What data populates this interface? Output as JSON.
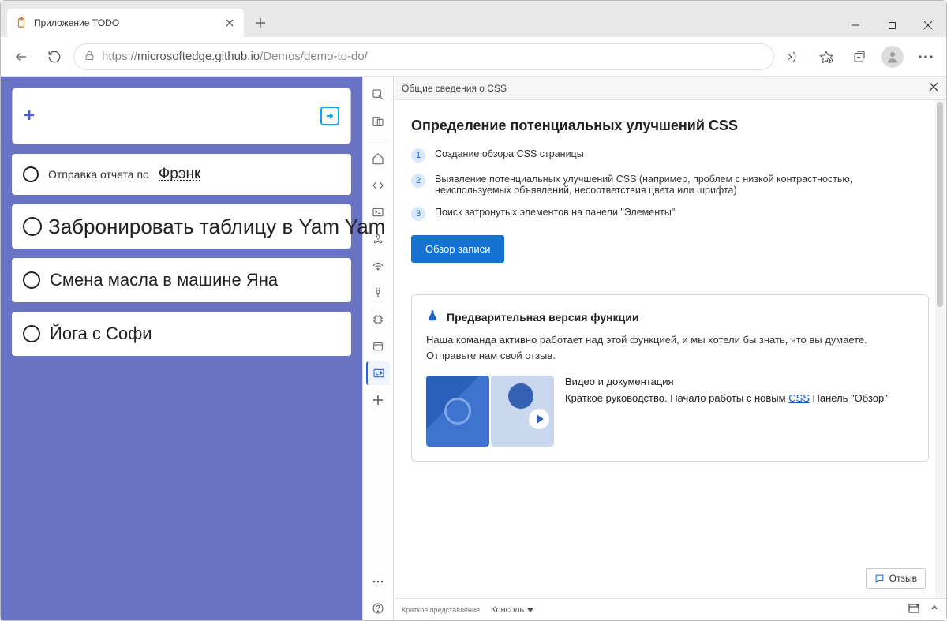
{
  "browser": {
    "tab_title": "Приложение TODO",
    "url_prefix": "https://",
    "url_host": "microsoftedge.github.io",
    "url_path": "/Demos/demo-to-do/"
  },
  "todo": {
    "items": [
      {
        "prefix": "Отправка отчета по",
        "name": "Фрэнк"
      },
      {
        "text": "Забронировать таблицу в Yam Yam"
      },
      {
        "text": "Смена масла в машине Яна"
      },
      {
        "text": "Йога с Софи"
      }
    ]
  },
  "devtools": {
    "panel_title": "Общие сведения о CSS",
    "heading": "Определение потенциальных улучшений CSS",
    "steps": [
      "Создание обзора CSS страницы",
      "Выявление потенциальных улучшений CSS (например, проблем с низкой контрастностью, неиспользуемых объявлений, несоответствия цвета или шрифта)",
      "Поиск затронутых элементов на панели \"Элементы\""
    ],
    "capture_button": "Обзор записи",
    "preview": {
      "title": "Предварительная версия функции",
      "desc": "Наша команда активно работает над этой функцией, и мы хотели бы знать, что вы думаете. Отправьте нам свой отзыв.",
      "media_title": "Видео и документация",
      "media_line_a": "Краткое руководство. Начало работы с новым ",
      "media_link": "CSS",
      "media_line_b": " Панель \"Обзор\""
    },
    "feedback": "Отзыв",
    "drawer": {
      "quick": "Краткое представление",
      "console": "Консоль"
    }
  }
}
